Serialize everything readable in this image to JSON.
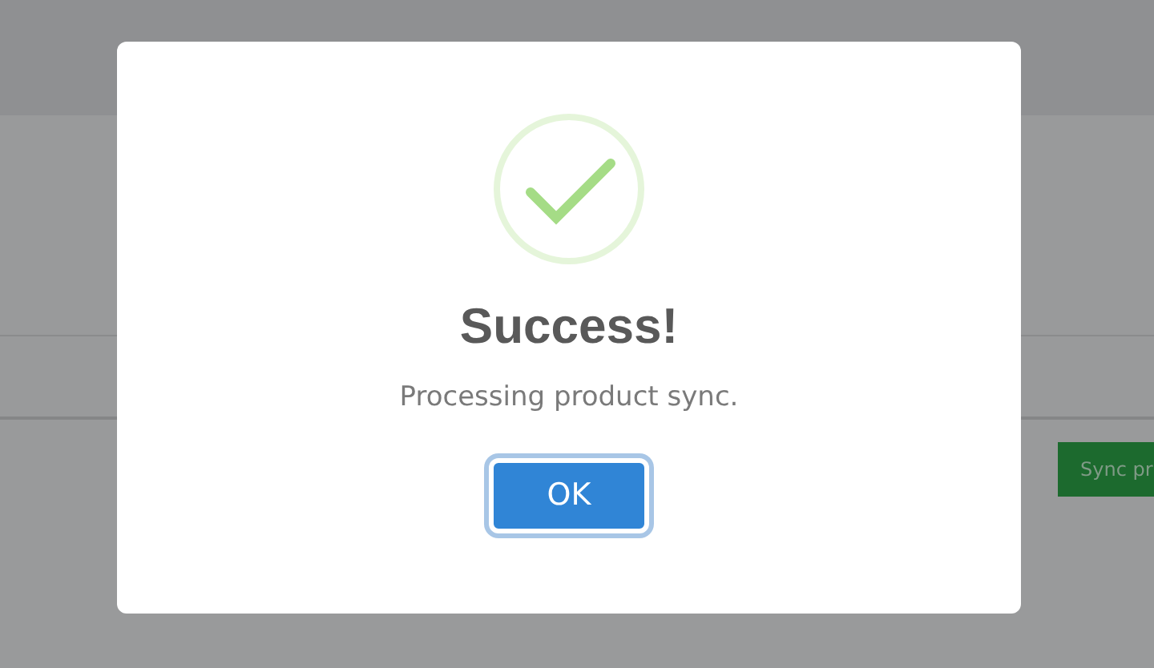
{
  "page": {
    "sync_button": "Sync pr"
  },
  "dialog": {
    "kind": "success",
    "title": "Success!",
    "text": "Processing product sync.",
    "confirm_button": "OK"
  }
}
